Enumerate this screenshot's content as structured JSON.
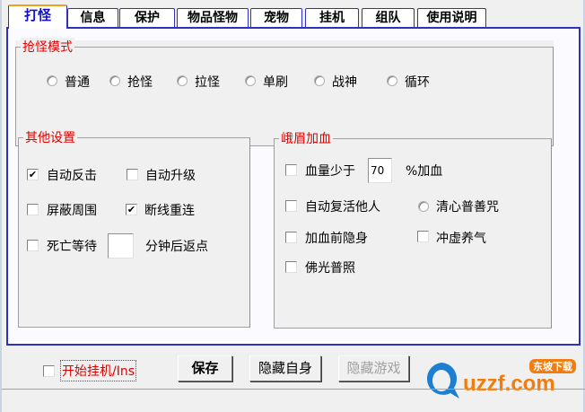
{
  "tabs": [
    "打怪",
    "信息",
    "保护",
    "物品怪物",
    "宠物",
    "挂机",
    "组队",
    "使用说明"
  ],
  "grab_mode": {
    "title": "抢怪模式",
    "options": [
      "普通",
      "抢怪",
      "拉怪",
      "单刷",
      "战神",
      "循环"
    ]
  },
  "other": {
    "title": "其他设置",
    "auto_counter": "自动反击",
    "auto_upgrade": "自动升级",
    "block_around": "屏蔽周围",
    "reconnect": "断线重连",
    "death_wait": "死亡等待",
    "death_wait_value": "",
    "death_wait_suffix": "分钟后返点"
  },
  "emei": {
    "title": "峨眉加血",
    "hp_below": "血量少于",
    "hp_value": "70",
    "hp_suffix": "%加血",
    "revive": "自动复活他人",
    "qingxin": "清心普善咒",
    "stealth": "加血前隐身",
    "chongxu": "冲虚养气",
    "foguang": "佛光普照"
  },
  "footer": {
    "start": "开始挂机/Ins",
    "save": "保存",
    "hide_self": "隐藏自身",
    "hide_game": "隐藏游戏"
  },
  "logo": {
    "text": "uzzf.com",
    "badge": "东坡下载"
  }
}
